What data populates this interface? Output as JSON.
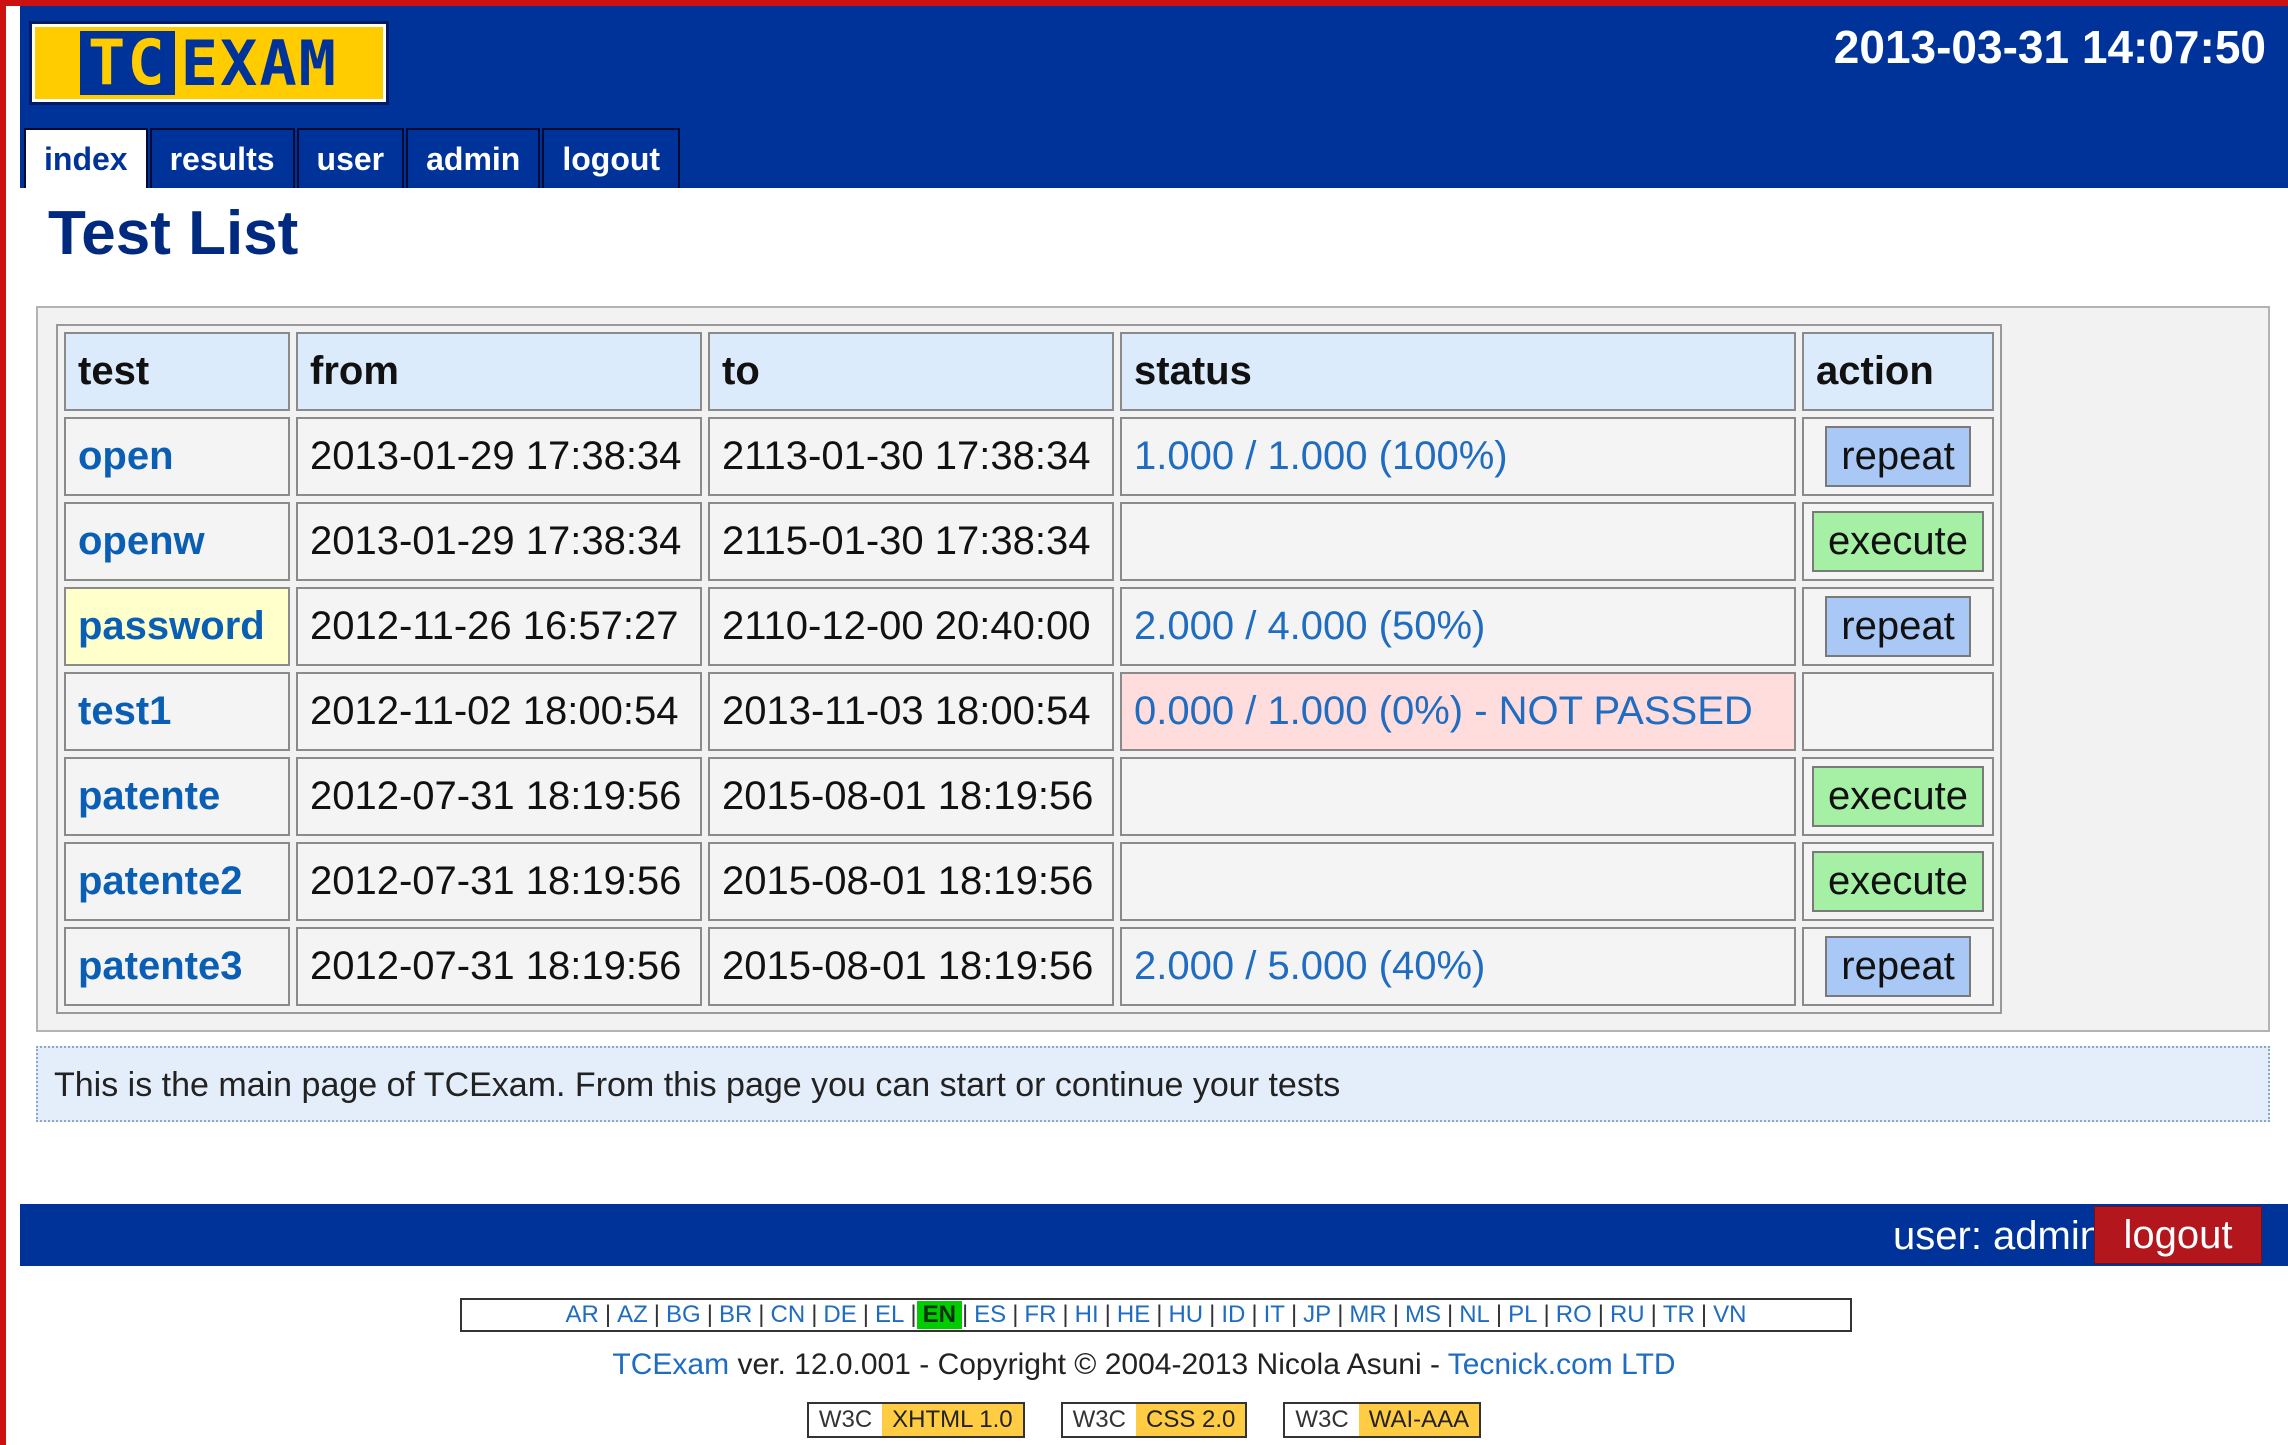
{
  "header": {
    "logo_text_a": "TC",
    "logo_text_b": "EXAM",
    "datetime": "2013-03-31 14:07:50"
  },
  "tabs": [
    {
      "label": "index",
      "active": true
    },
    {
      "label": "results",
      "active": false
    },
    {
      "label": "user",
      "active": false
    },
    {
      "label": "admin",
      "active": false
    },
    {
      "label": "logout",
      "active": false
    }
  ],
  "page_title": "Test List",
  "table": {
    "headers": [
      "test",
      "from",
      "to",
      "status",
      "action"
    ],
    "rows": [
      {
        "test": "open",
        "from": "2013-01-29 17:38:34",
        "to": "2113-01-30 17:38:34",
        "status": "1.000 / 1.000 (100%)",
        "action": "repeat"
      },
      {
        "test": "openw",
        "from": "2013-01-29 17:38:34",
        "to": "2115-01-30 17:38:34",
        "status": "",
        "action": "execute"
      },
      {
        "test": "password",
        "from": "2012-11-26 16:57:27",
        "to": "2110-12-00 20:40:00",
        "status": "2.000 / 4.000 (50%)",
        "action": "repeat"
      },
      {
        "test": "test1",
        "from": "2012-11-02 18:00:54",
        "to": "2013-11-03 18:00:54",
        "status": "0.000 / 1.000 (0%) - NOT PASSED",
        "action": ""
      },
      {
        "test": "patente",
        "from": "2012-07-31 18:19:56",
        "to": "2015-08-01 18:19:56",
        "status": "",
        "action": "execute"
      },
      {
        "test": "patente2",
        "from": "2012-07-31 18:19:56",
        "to": "2015-08-01 18:19:56",
        "status": "",
        "action": "execute"
      },
      {
        "test": "patente3",
        "from": "2012-07-31 18:19:56",
        "to": "2015-08-01 18:19:56",
        "status": "2.000 / 5.000 (40%)",
        "action": "repeat"
      }
    ]
  },
  "info_text": "This is the main page of TCExam. From this page you can start or continue your tests",
  "footer": {
    "user_label": "user: admin",
    "logout_label": "logout",
    "languages": [
      "AR",
      "AZ",
      "BG",
      "BR",
      "CN",
      "DE",
      "EL",
      "EN",
      "ES",
      "FR",
      "HI",
      "HE",
      "HU",
      "ID",
      "IT",
      "JP",
      "MR",
      "MS",
      "NL",
      "PL",
      "RO",
      "RU",
      "TR",
      "VN"
    ],
    "active_language": "EN",
    "copyright_app": "TCExam",
    "copyright_text": " ver. 12.0.001 - Copyright © 2004-2013 Nicola Asuni - ",
    "copyright_company": "Tecnick.com LTD",
    "badges": [
      {
        "w3c": "W3C",
        "std": "XHTML 1.0"
      },
      {
        "w3c": "W3C",
        "std": "CSS 2.0"
      },
      {
        "w3c": "W3C",
        "std": "WAI-AAA"
      }
    ]
  },
  "colors": {
    "header_bg": "#003399",
    "repeat_btn": "#a9c8f5",
    "execute_btn": "#a6f0a6",
    "fail_status_bg": "#ffdddd",
    "highlight_cell_bg": "#ffffcc",
    "logout_bg": "#b3161c"
  }
}
